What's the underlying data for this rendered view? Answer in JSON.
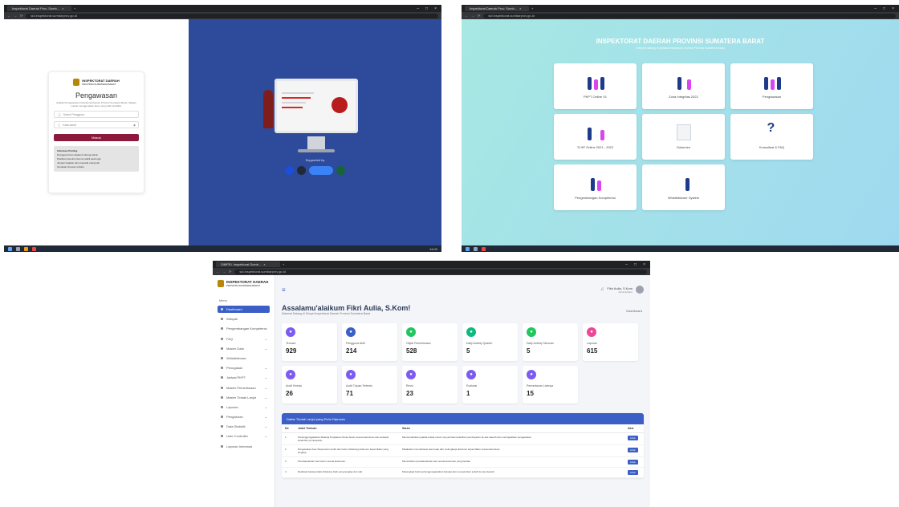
{
  "shot1": {
    "tab_title": "Inspektorat Daerah Prov. Sumb...",
    "url": "sid.inspektorat.sumbarprov.go.id",
    "brand_line1": "INSPEKTORAT DAERAH",
    "brand_line2": "PROVINSI SUMATERA BARAT",
    "login_title": "Pengawasan",
    "login_sub": "Aplikasi Pengawasan Inspektorat Daerah Provinsi Sumatera Barat. Silakan masuk menggunakan akun yang telah terdaftar.",
    "username_placeholder": "Nama Pengguna",
    "password_placeholder": "Kata sandi",
    "login_button": "Masuk",
    "info_title": "Informasi Penting",
    "info_lines": [
      "Pengguna baru silakan hubungi admin",
      "Pastikan koneksi internet stabil saat login",
      "Jangan bagikan akun kepada orang lain",
      "Gunakan browser terbaru"
    ],
    "support_label": "Supported by",
    "taskbar_time": "14:00"
  },
  "shot2": {
    "tab_title": "Inspektorat Daerah Prov. Sumb...",
    "url": "sid.inspektorat.sumbarprov.go.id",
    "title": "INSPEKTORAT DAERAH PROVINSI SUMATERA BARAT",
    "subtitle": "Selamat datang di aplikasi Inspektorat Daerah Provinsi Sumatera Barat",
    "cards": [
      "PKPT Online V1",
      "Zona Integritas 2022",
      "Pengawasan",
      "TLHP Online 2021 - 2022",
      "Dokumen",
      "Konsultasi & FAQ",
      "Pengembangan Kompetensi",
      "Whistleblower System"
    ]
  },
  "shot3": {
    "tab_title": "SIMPEL Inspektorat Sumb...",
    "url": "sid.inspektorat.sumbarprov.go.id",
    "brand_line1": "INSPEKTORAT DAERAH",
    "brand_line2": "PROVINSI SUMATERA BARAT",
    "menu_heading": "Menu",
    "sidebar": [
      {
        "label": "Dashboard",
        "active": true,
        "chev": false
      },
      {
        "label": "Wilayah",
        "active": false,
        "chev": false
      },
      {
        "label": "Pengembangan Kompetensi",
        "active": false,
        "chev": false
      },
      {
        "label": "FAQ",
        "active": false,
        "chev": true
      },
      {
        "label": "Master Data",
        "active": false,
        "chev": true
      },
      {
        "label": "Whistleblower",
        "active": false,
        "chev": false
      },
      {
        "label": "Penugasan",
        "active": false,
        "chev": true
      },
      {
        "label": "Jadwal PKPT",
        "active": false,
        "chev": true
      },
      {
        "label": "Master Pemeriksaan",
        "active": false,
        "chev": true
      },
      {
        "label": "Master Tindak Lanjut",
        "active": false,
        "chev": true
      },
      {
        "label": "Laporan",
        "active": false,
        "chev": true
      },
      {
        "label": "Pengaturan",
        "active": false,
        "chev": true
      },
      {
        "label": "Data Statistik",
        "active": false,
        "chev": true
      },
      {
        "label": "User Controller",
        "active": false,
        "chev": true
      },
      {
        "label": "Laporan Informasi",
        "active": false,
        "chev": false
      }
    ],
    "user_name": "Fikri Aulia, S.Kom",
    "user_role": "Administrator",
    "welcome": "Assalamu'alaikum Fikri Aulia, S.Kom!",
    "welcome_sub": "Selamat Datang di Simpel Inspektorat Daerah Provinsi Sumatera Barat",
    "breadcrumb": "Dashboard",
    "stats": [
      {
        "label": "Temuan",
        "value": "929",
        "color": "#7c5cf0"
      },
      {
        "label": "Pengguna Aktif",
        "value": "214",
        "color": "#3b5fc6"
      },
      {
        "label": "Objek Pemeriksaan",
        "value": "528",
        "color": "#22c55e"
      },
      {
        "label": "Daily Activity Quarter",
        "value": "5",
        "color": "#10b981"
      },
      {
        "label": "Daily Activity Tahunan",
        "value": "5",
        "color": "#22c55e"
      },
      {
        "label": "Laporan",
        "value": "615",
        "color": "#ec4899"
      },
      {
        "label": "Audit Kinerja",
        "value": "26",
        "color": "#7c5cf0"
      },
      {
        "label": "Audit Tujuan Tertentu",
        "value": "71",
        "color": "#7c5cf0"
      },
      {
        "label": "Reviu",
        "value": "23",
        "color": "#7c5cf0"
      },
      {
        "label": "Evaluasi",
        "value": "1",
        "color": "#7c5cf0"
      },
      {
        "label": "Pemantauan Lainnya",
        "value": "15",
        "color": "#7c5cf0"
      }
    ],
    "panel_title": "Daftar Tindak Lanjut yang Perlu Diproses",
    "columns": [
      "No",
      "Judul Temuan",
      "Saran",
      "Aksi"
    ],
    "rows": [
      {
        "no": "1",
        "judul": "Pertanggungjawaban Belanja Perjalanan Dinas belum sesuai ketentuan dan terdapat kelebihan pembayaran.",
        "saran": "Memerintahkan pejabat terkait untuk menyetorkan kelebihan pembayaran ke kas daerah dan meningkatkan pengawasan.",
        "aksi": "Lihat"
      },
      {
        "no": "2",
        "judul": "Pengelolaan Aset Tetap belum tertib dan belum didukung dokumen kepemilikan yang lengkap.",
        "saran": "Melakukan inventarisasi aset tetap dan melengkapi dokumen kepemilikan sesuai ketentuan.",
        "aksi": "Lihat"
      },
      {
        "no": "3",
        "judul": "Penatausahaan kas belum sesuai ketentuan.",
        "saran": "Menertibkan penatausahaan kas sesuai ketentuan yang berlaku.",
        "aksi": "Lihat"
      },
      {
        "no": "4",
        "judul": "Realisasi belanja tidak didukung bukti yang lengkap dan sah.",
        "saran": "Melengkapi bukti pertanggungjawaban belanja dan menyetorkan selisih ke kas daerah.",
        "aksi": "Lihat"
      }
    ]
  }
}
